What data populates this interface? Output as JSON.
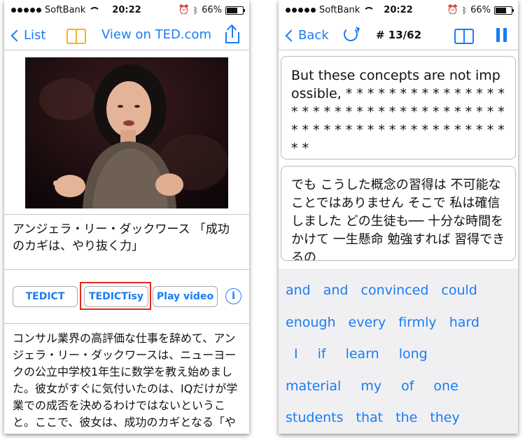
{
  "status_left": {
    "carrier": "SoftBank",
    "time": "20:22",
    "battery": "66%",
    "battery_level": 0.66
  },
  "status_right": {
    "carrier": "SoftBank",
    "time": "20:22",
    "battery": "66%",
    "battery_level": 0.66
  },
  "left_nav": {
    "back_label": "List",
    "ted_link": "View on TED.com"
  },
  "talk": {
    "title": "アンジェラ・リー・ダックワース 「成功のカギは、やり抜く力」",
    "buttons": {
      "tedict": "TEDICT",
      "tedictisy": "TEDICTisy",
      "play": "Play video"
    },
    "info_symbol": "i",
    "description": "コンサル業界の高評価な仕事を辞めて、アンジェラ・リー・ダックワースは、ニューヨークの公立中学校1年生に数学を教え始めました。彼女がすぐに気付いたのは、IQだけが学業での成否を決めるわけではないということ。ここで、彼女は、成功のカギとなる「やり"
  },
  "right_nav": {
    "back_label": "Back",
    "counter": "# 13/62"
  },
  "sentence": {
    "english": "But these concepts are not impossible, * * * * * * * * * * * * * * * * * * * * * * * * * * * * * * * * * * * * * * * * * * * * * * * * * * * * * * * * *",
    "japanese": "でも こうした概念の習得は 不可能なことではありません そこで 私は確信しました どの生徒も── 十分な時間をかけて 一生懸命 勉強すれば 習得できるの"
  },
  "word_bank": [
    [
      "and",
      "and",
      "convinced",
      "could"
    ],
    [
      "enough",
      "every",
      "firmly",
      "hard"
    ],
    [
      "I",
      "if",
      "learn",
      "long"
    ],
    [
      "material",
      "my",
      "of",
      "one"
    ],
    [
      "students",
      "that",
      "the",
      "they"
    ]
  ],
  "colors": {
    "accent": "#1a7cf5",
    "book_icon_left": "#f2b324",
    "highlight": "#e3261f"
  }
}
